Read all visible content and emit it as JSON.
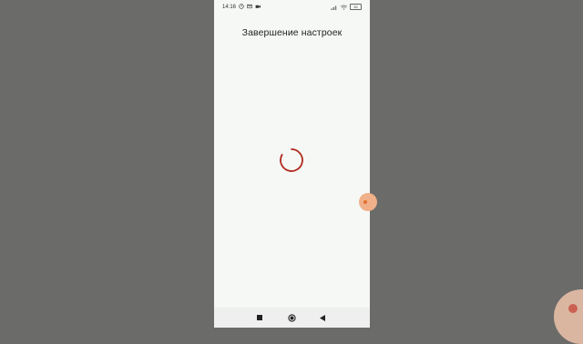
{
  "status_bar": {
    "time": "14:16",
    "battery": "32"
  },
  "screen": {
    "title": "Завершение настроек"
  },
  "colors": {
    "spinner": "#b02a1d",
    "background": "#f6f8f5",
    "outside": "#6b6b69"
  },
  "icons": [
    "clock-icon",
    "email-icon",
    "video-icon",
    "signal-icon",
    "wifi-icon",
    "battery-icon",
    "stop-icon",
    "home-icon",
    "back-icon"
  ]
}
